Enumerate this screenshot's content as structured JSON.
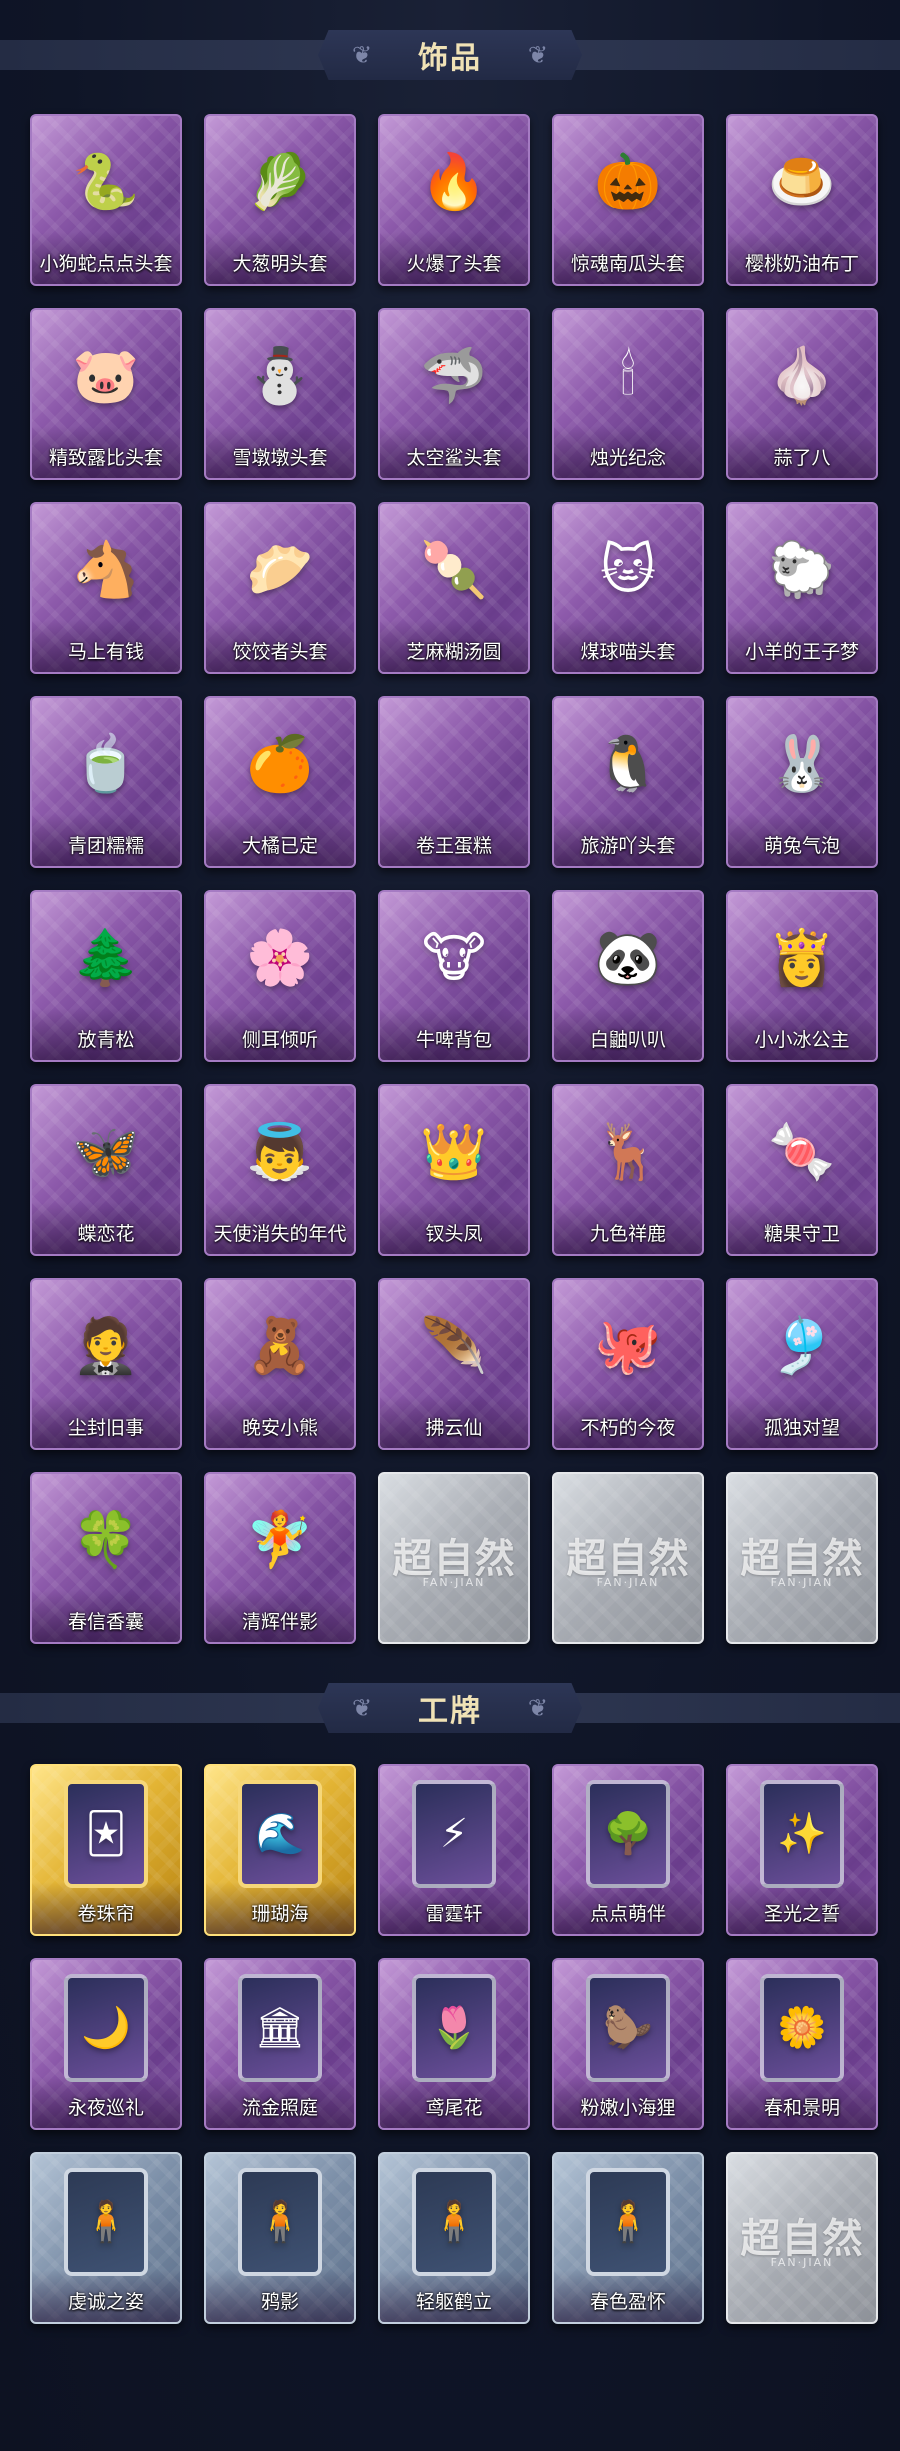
{
  "sections": [
    {
      "title": "饰品",
      "items": [
        {
          "label": "小狗蛇点点头套",
          "style": "purple",
          "icon": "🐍"
        },
        {
          "label": "大葱明头套",
          "style": "purple",
          "icon": "🥬"
        },
        {
          "label": "火爆了头套",
          "style": "purple",
          "icon": "🔥"
        },
        {
          "label": "惊魂南瓜头套",
          "style": "purple",
          "icon": "🎃"
        },
        {
          "label": "樱桃奶油布丁",
          "style": "purple",
          "icon": "🍮"
        },
        {
          "label": "精致露比头套",
          "style": "purple",
          "icon": "🐷"
        },
        {
          "label": "雪墩墩头套",
          "style": "purple",
          "icon": "⛄"
        },
        {
          "label": "太空鲨头套",
          "style": "purple",
          "icon": "🦈"
        },
        {
          "label": "烛光纪念",
          "style": "purple",
          "icon": "🕯"
        },
        {
          "label": "蒜了八",
          "style": "purple",
          "icon": "🧄"
        },
        {
          "label": "马上有钱",
          "style": "purple",
          "icon": "🐴"
        },
        {
          "label": "饺饺者头套",
          "style": "purple",
          "icon": "🥟"
        },
        {
          "label": "芝麻糊汤圆",
          "style": "purple",
          "icon": "🍡"
        },
        {
          "label": "煤球喵头套",
          "style": "purple",
          "icon": "🐱"
        },
        {
          "label": "小羊的王子梦",
          "style": "purple",
          "icon": "🐑"
        },
        {
          "label": "青团糯糯",
          "style": "purple",
          "icon": "🍵"
        },
        {
          "label": "大橘已定",
          "style": "purple",
          "icon": "🍊"
        },
        {
          "label": "卷王蛋糕",
          "style": "purple",
          "icon": ""
        },
        {
          "label": "旅游吖头套",
          "style": "purple",
          "icon": "🐧"
        },
        {
          "label": "萌兔气泡",
          "style": "purple",
          "icon": "🐰"
        },
        {
          "label": "放青松",
          "style": "purple",
          "icon": "🌲"
        },
        {
          "label": "侧耳倾听",
          "style": "purple",
          "icon": "🌸"
        },
        {
          "label": "牛啤背包",
          "style": "purple",
          "icon": "🐮"
        },
        {
          "label": "白鼬叭叭",
          "style": "purple",
          "icon": "🐼"
        },
        {
          "label": "小小冰公主",
          "style": "purple",
          "icon": "👸"
        },
        {
          "label": "蝶恋花",
          "style": "purple",
          "icon": "🦋"
        },
        {
          "label": "天使消失的年代",
          "style": "purple",
          "icon": "👼"
        },
        {
          "label": "钗头凤",
          "style": "purple",
          "icon": "👑"
        },
        {
          "label": "九色祥鹿",
          "style": "purple",
          "icon": "🦌"
        },
        {
          "label": "糖果守卫",
          "style": "purple",
          "icon": "🍬"
        },
        {
          "label": "尘封旧事",
          "style": "purple",
          "icon": "🤵"
        },
        {
          "label": "晚安小熊",
          "style": "purple",
          "icon": "🧸"
        },
        {
          "label": "拂云仙",
          "style": "purple",
          "icon": "🪶"
        },
        {
          "label": "不朽的今夜",
          "style": "purple",
          "icon": "🐙"
        },
        {
          "label": "孤独对望",
          "style": "purple",
          "icon": "🎐"
        },
        {
          "label": "春信香囊",
          "style": "purple",
          "icon": "🍀"
        },
        {
          "label": "清辉伴影",
          "style": "purple",
          "icon": "🧚"
        },
        {
          "label": "",
          "style": "silver",
          "icon": ""
        },
        {
          "label": "",
          "style": "silver",
          "icon": ""
        },
        {
          "label": "",
          "style": "silver",
          "icon": ""
        }
      ]
    },
    {
      "title": "工牌",
      "items": [
        {
          "label": "卷珠帘",
          "style": "gold",
          "icon": "🃏"
        },
        {
          "label": "珊瑚海",
          "style": "gold",
          "icon": "🌊"
        },
        {
          "label": "雷霆轩",
          "style": "purple",
          "icon": "⚡"
        },
        {
          "label": "点点萌伴",
          "style": "purple",
          "icon": "🌳"
        },
        {
          "label": "圣光之誓",
          "style": "purple",
          "icon": "✨"
        },
        {
          "label": "永夜巡礼",
          "style": "purple",
          "icon": "🌙"
        },
        {
          "label": "流金照庭",
          "style": "purple",
          "icon": "🏛"
        },
        {
          "label": "鸢尾花",
          "style": "purple",
          "icon": "🌷"
        },
        {
          "label": "粉嫩小海狸",
          "style": "purple",
          "icon": "🦫"
        },
        {
          "label": "春和景明",
          "style": "purple",
          "icon": "🌼"
        },
        {
          "label": "虔诚之姿",
          "style": "blue",
          "icon": "🧍"
        },
        {
          "label": "鸦影",
          "style": "blue",
          "icon": "🧍"
        },
        {
          "label": "轻躯鹤立",
          "style": "blue",
          "icon": "🧍"
        },
        {
          "label": "春色盈怀",
          "style": "blue",
          "icon": "🧍"
        },
        {
          "label": "",
          "style": "silver",
          "icon": ""
        }
      ]
    }
  ],
  "placeholder": {
    "watermark": "超自然",
    "sub": "FAN·JIAN"
  }
}
